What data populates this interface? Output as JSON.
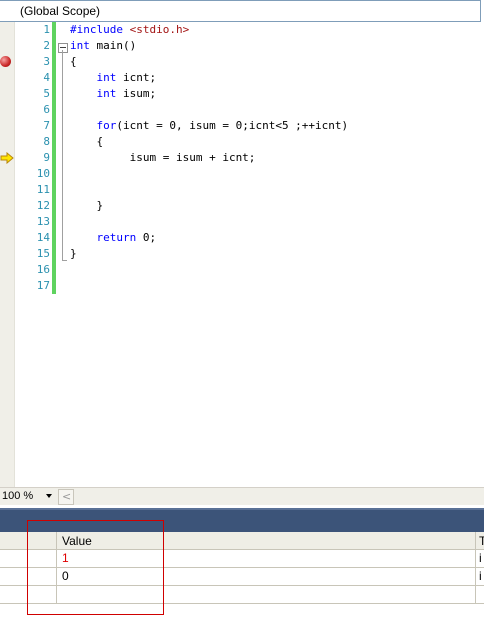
{
  "scope": {
    "label": "(Global Scope)"
  },
  "editor": {
    "line_numbers": [
      "1",
      "2",
      "3",
      "4",
      "5",
      "6",
      "7",
      "8",
      "9",
      "10",
      "11",
      "12",
      "13",
      "14",
      "15",
      "16",
      "17"
    ],
    "code": [
      {
        "parts": [
          {
            "t": "#include ",
            "c": "kw"
          },
          {
            "t": "<stdio.h>",
            "c": "str"
          }
        ]
      },
      {
        "parts": [
          {
            "t": "int",
            "c": "kw"
          },
          {
            "t": " main()",
            "c": ""
          }
        ]
      },
      {
        "parts": [
          {
            "t": "{",
            "c": ""
          }
        ]
      },
      {
        "parts": [
          {
            "t": "    ",
            "c": ""
          },
          {
            "t": "int",
            "c": "kw"
          },
          {
            "t": " icnt;",
            "c": ""
          }
        ]
      },
      {
        "parts": [
          {
            "t": "    ",
            "c": ""
          },
          {
            "t": "int",
            "c": "kw"
          },
          {
            "t": " isum;",
            "c": ""
          }
        ]
      },
      {
        "parts": []
      },
      {
        "parts": [
          {
            "t": "    ",
            "c": ""
          },
          {
            "t": "for",
            "c": "kw"
          },
          {
            "t": "(icnt = 0, isum = 0;icnt<5 ;++icnt)",
            "c": ""
          }
        ]
      },
      {
        "parts": [
          {
            "t": "    {",
            "c": ""
          }
        ]
      },
      {
        "parts": [
          {
            "t": "         isum = isum + icnt;",
            "c": ""
          }
        ]
      },
      {
        "parts": []
      },
      {
        "parts": []
      },
      {
        "parts": [
          {
            "t": "    }",
            "c": ""
          }
        ]
      },
      {
        "parts": []
      },
      {
        "parts": [
          {
            "t": "    ",
            "c": ""
          },
          {
            "t": "return",
            "c": "kw"
          },
          {
            "t": " 0;",
            "c": ""
          }
        ]
      },
      {
        "parts": [
          {
            "t": "}",
            "c": ""
          }
        ]
      },
      {
        "parts": []
      },
      {
        "parts": []
      }
    ]
  },
  "zoom": {
    "level": "100 %",
    "scroll_left": "<"
  },
  "watch": {
    "header_value": "Value",
    "header_type": "T",
    "rows": [
      {
        "value": "1",
        "changed": true,
        "type": "i"
      },
      {
        "value": "0",
        "changed": false,
        "type": "i"
      },
      {
        "value": "",
        "changed": false,
        "type": ""
      }
    ]
  },
  "colors": {
    "keyword": "#0000ff",
    "string": "#a31515",
    "line_number": "#2b91af",
    "changed_value": "#e00000"
  }
}
